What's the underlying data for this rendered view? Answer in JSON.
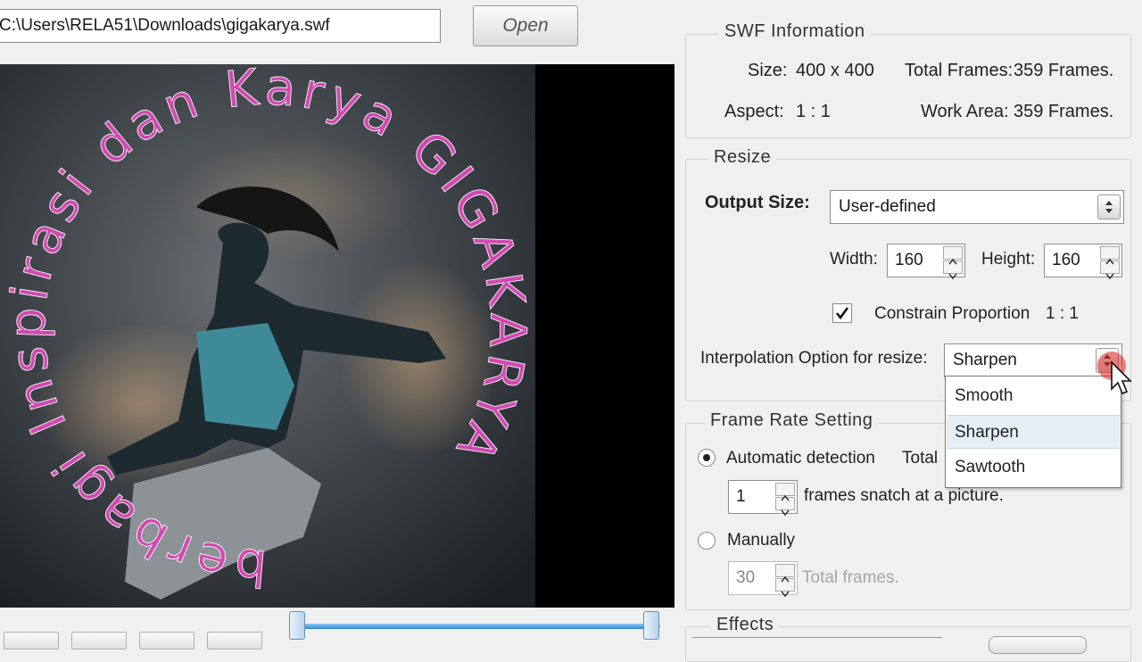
{
  "file": {
    "path": "C:\\Users\\RELA51\\Downloads\\gigakarya.swf",
    "open_label": "Open"
  },
  "swf_info": {
    "legend": "SWF Information",
    "size_label": "Size:",
    "size_value": "400 x 400",
    "total_frames_label": "Total Frames:",
    "total_frames_value": "359 Frames.",
    "aspect_label": "Aspect:",
    "aspect_value": "1 : 1",
    "work_area_label": "Work Area:",
    "work_area_value": "359 Frames."
  },
  "resize": {
    "legend": "Resize",
    "output_size_label": "Output Size:",
    "output_size_value": "User-defined",
    "width_label": "Width:",
    "width_value": "160",
    "height_label": "Height:",
    "height_value": "160",
    "constrain_label": "Constrain Proportion",
    "constrain_ratio": "1 : 1",
    "constrain_checked": true,
    "interpolation_label": "Interpolation Option for resize:",
    "interpolation_value": "Sharpen",
    "interpolation_options": [
      "Smooth",
      "Sharpen",
      "Sawtooth"
    ]
  },
  "frame_rate": {
    "legend": "Frame Rate Setting",
    "auto_label": "Automatic detection",
    "auto_suffix": "Total",
    "auto_selected": true,
    "snatch_value": "1",
    "snatch_label": "frames snatch at a picture.",
    "manual_label": "Manually",
    "manual_value": "30",
    "manual_suffix": "Total frames."
  },
  "effects": {
    "legend": "Effects"
  },
  "preview": {
    "circle_text": "berbagi Inspirasi dan Karya GIGAKARYA"
  },
  "timeline": {
    "start": 0,
    "end": 1
  },
  "colors": {
    "accent": "#2f86d6",
    "cursor_highlight": "#e02020"
  }
}
